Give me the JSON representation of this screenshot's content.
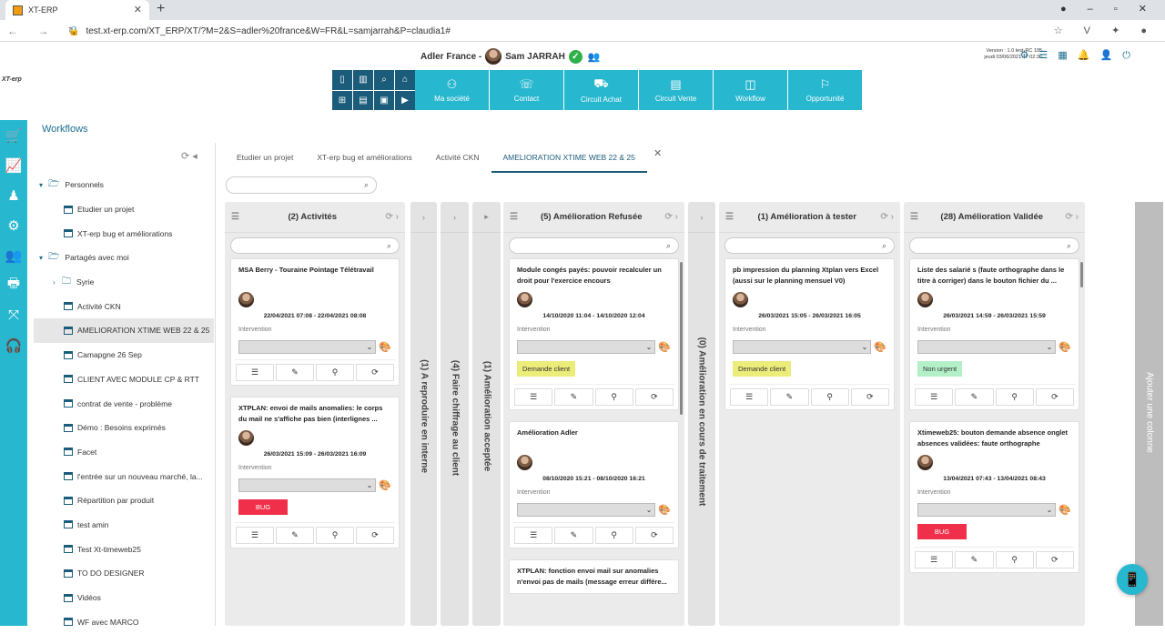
{
  "browser": {
    "tab_title": "XT-ERP",
    "url": "test.xt-erp.com/XT_ERP/XT/?M=2&S=adler%20france&W=FR&L=samjarrah&P=claudia1#"
  },
  "logo": "XT-erp",
  "header": {
    "company": "Adler France -",
    "user": "Sam JARRAH",
    "version_line1": "Version : 1.0 test-RC 195",
    "version_line2": "jeudi 03/06/2021 17:02:36"
  },
  "main_buttons": [
    {
      "label": "Ma société",
      "icon": "people-icon",
      "glyph": "⚇"
    },
    {
      "label": "Contact",
      "icon": "contact-icon",
      "glyph": "☏"
    },
    {
      "label": "Circuit Achat",
      "icon": "cart-icon",
      "glyph": "⛟"
    },
    {
      "label": "Circuit Vente",
      "icon": "document-icon",
      "glyph": "▤"
    },
    {
      "label": "Workflow",
      "icon": "workflow-icon",
      "glyph": "◫"
    },
    {
      "label": "Opportunité",
      "icon": "opportunity-icon",
      "glyph": "⚐"
    }
  ],
  "workflows": {
    "title": "Workflows",
    "tree": [
      {
        "label": "Personnels",
        "type": "folder",
        "expanded": true,
        "level": 0
      },
      {
        "label": "Etudier un projet",
        "type": "board",
        "level": 1
      },
      {
        "label": "XT-erp bug et améliorations",
        "type": "board",
        "level": 1
      },
      {
        "label": "Partagés avec moi",
        "type": "folder",
        "expanded": true,
        "level": 0
      },
      {
        "label": "Syrie",
        "type": "folder",
        "expanded": false,
        "level": 1
      },
      {
        "label": "Activité CKN",
        "type": "board",
        "level": 1
      },
      {
        "label": "AMELIORATION XTIME WEB 22 & 25",
        "type": "board",
        "level": 1,
        "active": true
      },
      {
        "label": "Camapgne 26 Sep",
        "type": "board",
        "level": 1
      },
      {
        "label": "CLIENT AVEC MODULE CP & RTT",
        "type": "board",
        "level": 1
      },
      {
        "label": "contrat de vente - problème",
        "type": "board",
        "level": 1
      },
      {
        "label": "Démo : Besoins exprimés",
        "type": "board",
        "level": 1
      },
      {
        "label": "Facet",
        "type": "board",
        "level": 1
      },
      {
        "label": "l'entrée sur un nouveau marché, la...",
        "type": "board",
        "level": 1
      },
      {
        "label": "Répartition par produit",
        "type": "board",
        "level": 1
      },
      {
        "label": "test amin",
        "type": "board",
        "level": 1
      },
      {
        "label": "Test Xt-timeweb25",
        "type": "board",
        "level": 1
      },
      {
        "label": "TO DO DESIGNER",
        "type": "board",
        "level": 1
      },
      {
        "label": "Vidéos",
        "type": "board",
        "level": 1
      },
      {
        "label": "WF avec MARCO",
        "type": "board",
        "level": 1
      }
    ]
  },
  "tabs": [
    "Etudier un projet",
    "XT-erp bug et améliorations",
    "Activité CKN",
    "AMELIORATION XTIME WEB 22 & 25"
  ],
  "active_tab": 3,
  "columns": {
    "activites": {
      "title": "(2) Activités",
      "cards": [
        {
          "title": "MSA Berry - Touraine Pointage Télétravail",
          "date": "22/04/2021 07:08 - 22/04/2021 08:08",
          "type": "Intervention",
          "badge": "",
          "badge_color": ""
        },
        {
          "title": "XTPLAN: envoi de mails anomalies:  le corps du mail ne s'affiche pas bien (interlignes ...",
          "date": "26/03/2021 15:09 - 26/03/2021 16:09",
          "type": "Intervention",
          "badge": "BUG",
          "badge_color": "#f0304a"
        }
      ]
    },
    "collapsed": [
      "(1) A reproduire en interne",
      "(4) Faire chiffrage au client",
      "(1) Amélioration acceptée",
      "(0) Amélioration en cours de traitement"
    ],
    "refusee": {
      "title": "(5) Amélioration Refusée",
      "cards": [
        {
          "title": "Module congés payés: pouvoir recalculer un droit  pour l'exercice encours",
          "date": "14/10/2020 11:04 - 14/10/2020 12:04",
          "type": "Intervention",
          "badge": "Demande client",
          "badge_color": "#ecec7a"
        },
        {
          "title": "Amélioration Adler",
          "date": "08/10/2020 15:21 - 08/10/2020 16:21",
          "type": "Intervention",
          "badge": "",
          "badge_color": ""
        },
        {
          "title": "XTPLAN: fonction envoi mail sur anomalies n'envoi pas de mails (message erreur différe...",
          "date": "",
          "type": "",
          "badge": "",
          "badge_color": ""
        }
      ]
    },
    "atester": {
      "title": "(1) Amélioration à tester",
      "cards": [
        {
          "title": "pb impression du planning Xtplan vers Excel (aussi sur le planning mensuel V0)",
          "date": "26/03/2021 15:05 - 26/03/2021 16:05",
          "type": "Intervention",
          "badge": "Demande client",
          "badge_color": "#ecec7a"
        }
      ]
    },
    "validee": {
      "title": "(28) Amélioration Validée",
      "cards": [
        {
          "title": "Liste des salarié s   (faute orthographe dans le titre à corriger) dans le bouton fichier du ...",
          "date": "26/03/2021 14:59 - 26/03/2021 15:59",
          "type": "Intervention",
          "badge": "Non urgent",
          "badge_color": "#b3f0c8"
        },
        {
          "title": "Xtimeweb25: bouton demande absence onglet absences validées: faute orthographe",
          "date": "13/04/2021 07:43 - 13/04/2021 08:43",
          "type": "Intervention",
          "badge": "BUG",
          "badge_color": "#f0304a"
        }
      ]
    }
  },
  "add_column_label": "Ajouter une colonne",
  "colors": {
    "accent": "#27b7cf",
    "dark": "#1a5c7a"
  }
}
